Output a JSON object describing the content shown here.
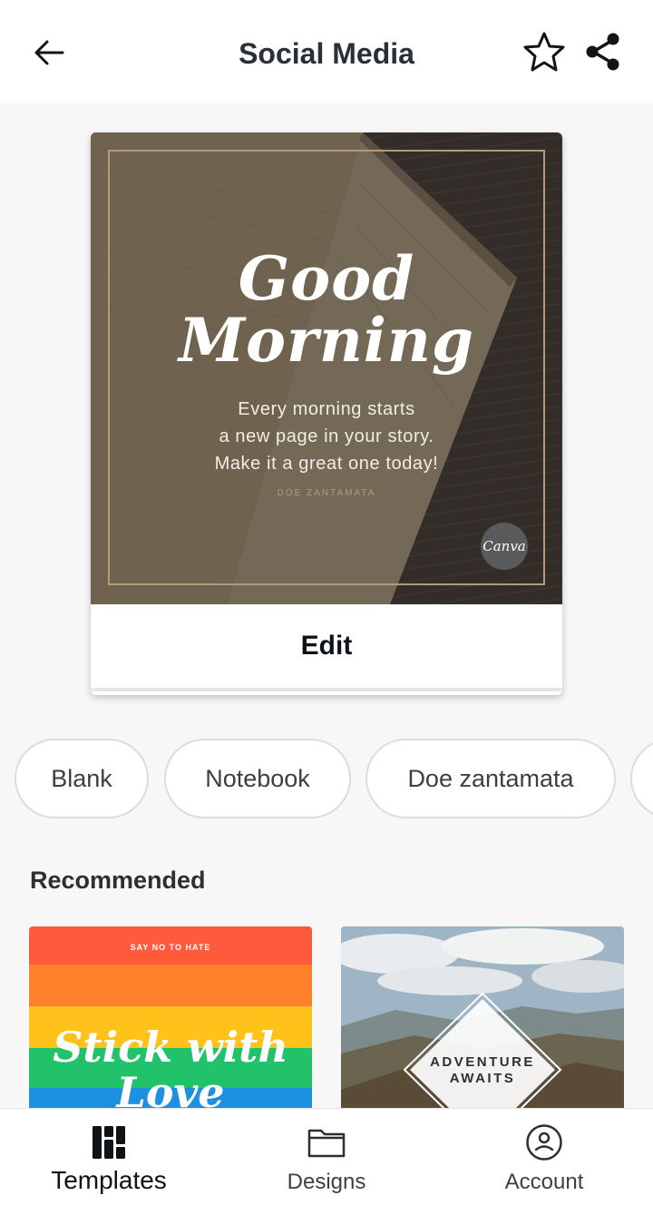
{
  "header": {
    "title": "Social Media",
    "back_icon": "arrow-left-icon",
    "favorite_icon": "star-outline-icon",
    "share_icon": "share-icon"
  },
  "preview": {
    "headline_line1": "Good",
    "headline_line2": "Morning",
    "quote_line1": "Every morning starts",
    "quote_line2": "a new page in your story.",
    "quote_line3": "Make it a great one today!",
    "author": "DOE ZANTAMATA",
    "badge": "Canva",
    "edit_label": "Edit"
  },
  "chips": [
    {
      "label": "Blank"
    },
    {
      "label": "Notebook"
    },
    {
      "label": "Doe zantamata"
    }
  ],
  "recommended": {
    "title": "Recommended",
    "items": [
      {
        "small_text": "SAY NO TO HATE",
        "script_line1": "Stick with",
        "script_line2": "Love"
      },
      {
        "text_line1": "ADVENTURE",
        "text_line2": "AWAITS"
      }
    ]
  },
  "nav": {
    "items": [
      {
        "label": "Templates",
        "icon": "templates-grid-icon",
        "active": true
      },
      {
        "label": "Designs",
        "icon": "folder-icon",
        "active": false
      },
      {
        "label": "Account",
        "icon": "account-circle-icon",
        "active": false
      }
    ]
  },
  "colors": {
    "rainbow": [
      "#ff5a3c",
      "#ff7f2a",
      "#ffc21a",
      "#22c26a",
      "#1e90e0"
    ]
  }
}
